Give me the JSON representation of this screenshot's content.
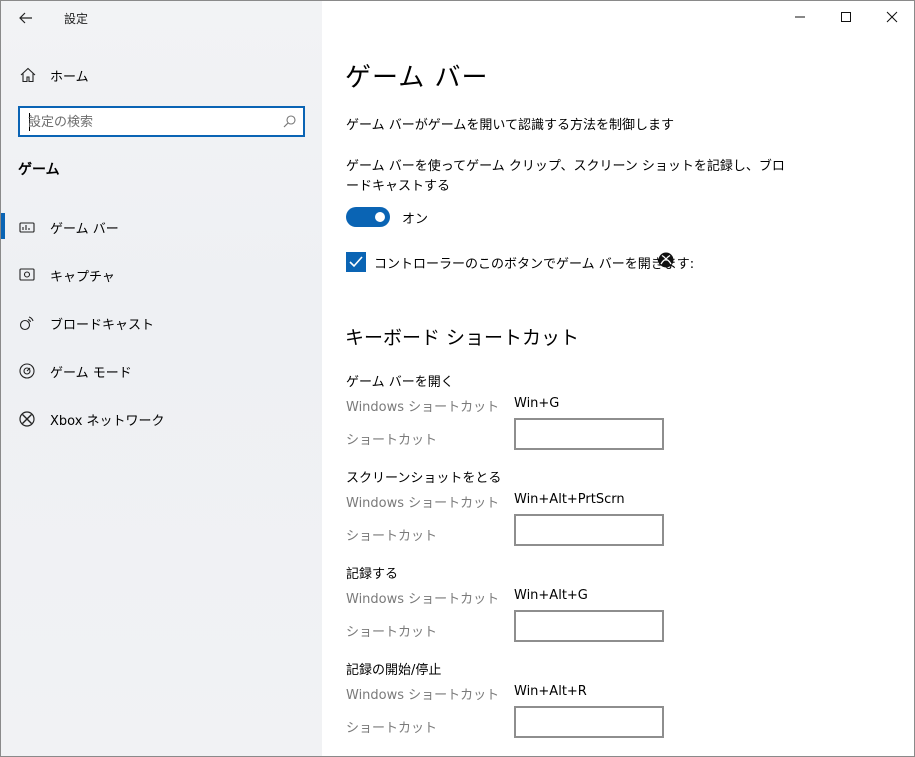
{
  "window": {
    "title": "設定",
    "controls": [
      "minimize",
      "maximize",
      "close"
    ]
  },
  "sidebar": {
    "home_label": "ホーム",
    "search_placeholder": "設定の検索",
    "section_heading": "ゲーム",
    "items": [
      {
        "label": "ゲーム バー",
        "icon": "game-bar-icon",
        "active": true
      },
      {
        "label": "キャプチャ",
        "icon": "capture-icon",
        "active": false
      },
      {
        "label": "ブロードキャスト",
        "icon": "broadcast-icon",
        "active": false
      },
      {
        "label": "ゲーム モード",
        "icon": "game-mode-icon",
        "active": false
      },
      {
        "label": "Xbox ネットワーク",
        "icon": "xbox-icon",
        "active": false
      }
    ]
  },
  "main": {
    "title": "ゲーム バー",
    "description": "ゲーム バーがゲームを開いて認識する方法を制御します",
    "toggle_description": "ゲーム バーを使ってゲーム クリップ、スクリーン ショットを記録し、ブロードキャストする",
    "toggle_state": "オン",
    "checkbox_label": "コントローラーのこのボタンでゲーム バーを開きます:",
    "checkbox_checked": true,
    "shortcuts_title": "キーボード ショートカット",
    "shortcuts": [
      {
        "title": "ゲーム バーを開く",
        "windows_label": "Windows ショートカット",
        "windows_value": "Win+G",
        "custom_label": "ショートカット",
        "custom_value": ""
      },
      {
        "title": "スクリーンショットをとる",
        "windows_label": "Windows ショートカット",
        "windows_value": "Win+Alt+PrtScrn",
        "custom_label": "ショートカット",
        "custom_value": ""
      },
      {
        "title": "記録する",
        "windows_label": "Windows ショートカット",
        "windows_value": "Win+Alt+G",
        "custom_label": "ショートカット",
        "custom_value": ""
      },
      {
        "title": "記録の開始/停止",
        "windows_label": "Windows ショートカット",
        "windows_value": "Win+Alt+R",
        "custom_label": "ショートカット",
        "custom_value": ""
      }
    ]
  },
  "colors": {
    "accent": "#0a64b4",
    "sidebar_bg": "#f0f2f4",
    "secondary_text": "#7a7a7a"
  }
}
